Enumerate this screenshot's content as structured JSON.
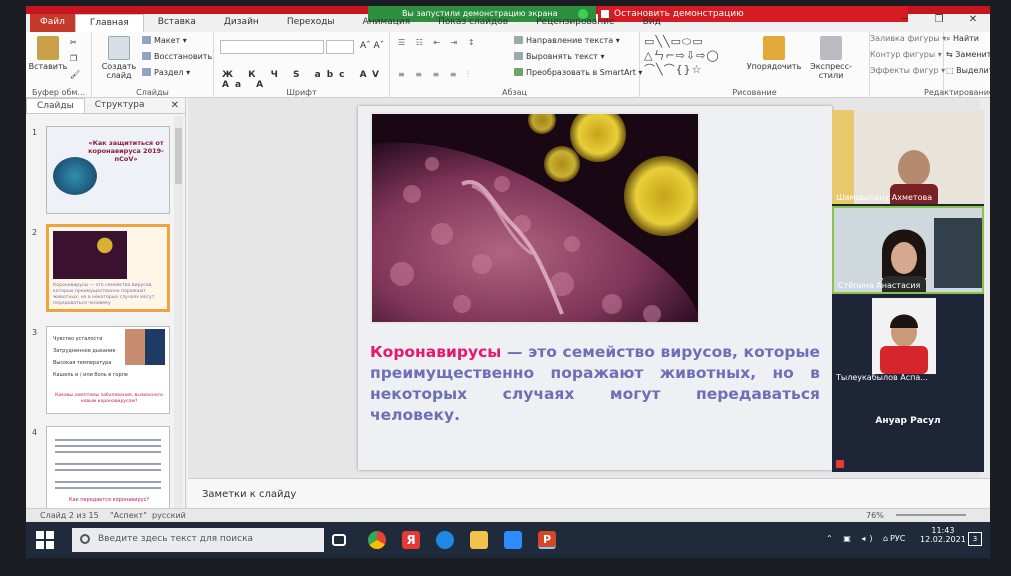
{
  "demo": {
    "notice": "Вы запустили демонстрацию экрана",
    "stop_label": "Остановить демонстрацию"
  },
  "window_controls": [
    "─",
    "❐",
    "✕"
  ],
  "ribbon_tabs": [
    "Файл",
    "Главная",
    "Вставка",
    "Дизайн",
    "Переходы",
    "Анимация",
    "Показ слайдов",
    "Рецензирование",
    "Вид"
  ],
  "ribbon": {
    "clipboard": {
      "paste": "Вставить",
      "label": "Буфер обм..."
    },
    "slides": {
      "new_slide": "Создать слайд",
      "layout": "Макет",
      "reset": "Восстановить",
      "section": "Раздел",
      "label": "Слайды"
    },
    "font": {
      "label": "Шрифт",
      "format_buttons": "Ж К Ч S abc AV Aa A"
    },
    "paragraph": {
      "text_direction": "Направление текста",
      "align_text": "Выровнять текст",
      "smartart": "Преобразовать в SmartArt",
      "label": "Абзац"
    },
    "drawing": {
      "arrange": "Упорядочить",
      "quick_styles": "Экспресс-стили",
      "fill": "Заливка фигуры",
      "outline": "Контур фигуры",
      "effects": "Эффекты фигур",
      "label": "Рисование"
    },
    "editing": {
      "find": "Найти",
      "replace": "Заменить",
      "select": "Выделить",
      "label": "Редактирование"
    }
  },
  "left_panel": {
    "tabs": [
      "Слайды",
      "Структура"
    ],
    "close": "✕",
    "slide1_title": "«Как защититься от коронавируса 2019-nCoV»",
    "slide2_text": "Коронавирусы — это семейство вирусов, которые преимущественно поражают животных, но в некоторых случаях могут передаваться человеку",
    "slide3_items": [
      "Чувство усталости",
      "Затрудненное дыхание",
      "Высокая температура",
      "Кашель и / или боль в горле"
    ],
    "slide3_question": "Каковы симптомы заболевания, вызванного новым коронавирусом?",
    "slide4_question": "Как передается коронавирус?"
  },
  "slide": {
    "highlight": "Коронавирусы",
    "body": " — это семейство вирусов, которые преимущественно поражают животных, но в некоторых случаях могут передаваться человеку."
  },
  "participants": [
    {
      "name": "Шамшыпану Ахметова",
      "colors": {
        "bg": "#e9e4da",
        "skin": "#b58a6e",
        "shirt": "#7a1f23"
      }
    },
    {
      "name": "Стёпина Анастасия",
      "colors": {
        "bg": "#cfd8dc",
        "skin": "#d6a890",
        "shirt": "#2a2a2a"
      }
    },
    {
      "name": "Тылеукабылов Аспа...",
      "colors": {
        "bg": "#f2f2f2",
        "skin": "#c99a7a",
        "shirt": "#d6262b"
      }
    },
    {
      "name": "Ануар Расул",
      "colors": {
        "bg": "#1e2537",
        "skin": "",
        "shirt": ""
      }
    }
  ],
  "notes_placeholder": "Заметки к слайду",
  "status": {
    "slide_of": "Слайд 2 из 15",
    "theme": "\"Аспект\"",
    "language": "русский",
    "zoom": "76%"
  },
  "taskbar": {
    "search_placeholder": "Введите здесь текст для поиска",
    "lang": "РУС",
    "time": "11:43",
    "date": "12.02.2021",
    "notifications": "3"
  }
}
